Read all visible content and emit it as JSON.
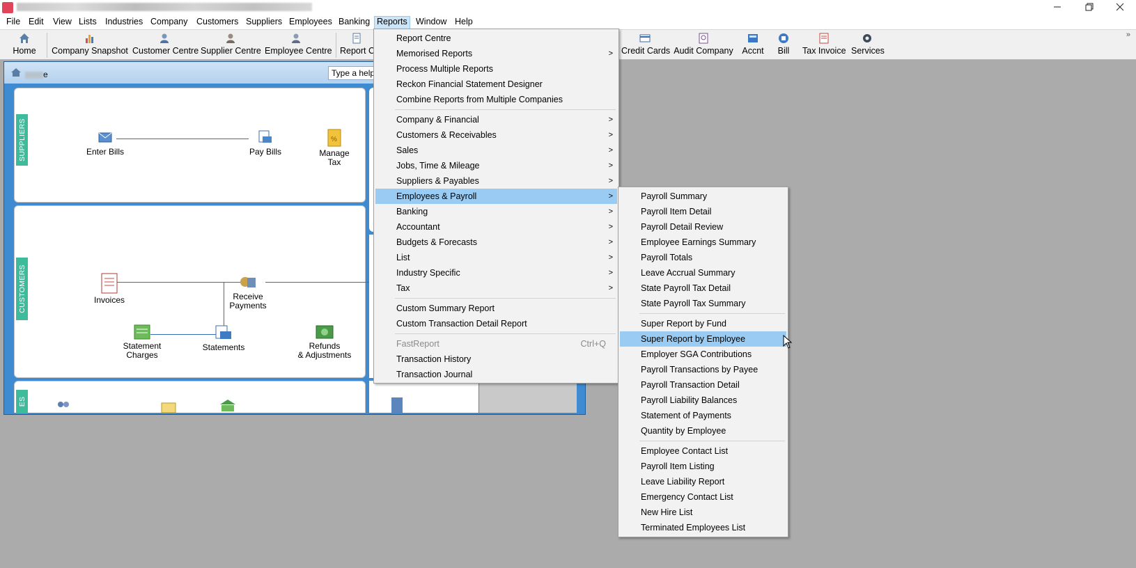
{
  "titlebar": {
    "minimize": "—",
    "restore": "❐",
    "close": "✕"
  },
  "menubar": [
    "File",
    "Edit",
    "View",
    "Lists",
    "Industries",
    "Company",
    "Customers",
    "Suppliers",
    "Employees",
    "Banking",
    "Reports",
    "Window",
    "Help"
  ],
  "toolbar": {
    "left": [
      {
        "label": "Home",
        "icon": "home-icon"
      },
      {
        "label": "Company Snapshot",
        "icon": "chart-icon"
      },
      {
        "label": "Customer Centre",
        "icon": "customer-icon"
      },
      {
        "label": "Supplier Centre",
        "icon": "supplier-icon"
      },
      {
        "label": "Employee Centre",
        "icon": "employee-icon"
      },
      {
        "label": "Report C",
        "icon": "report-icon"
      }
    ],
    "right": [
      {
        "label": "Credit Cards",
        "icon": "credit-card-icon"
      },
      {
        "label": "Audit Company",
        "icon": "audit-icon"
      },
      {
        "label": "Accnt",
        "icon": "account-icon"
      },
      {
        "label": "Bill",
        "icon": "bill-icon"
      },
      {
        "label": "Tax Invoice",
        "icon": "tax-invoice-icon"
      },
      {
        "label": "Services",
        "icon": "gear-icon"
      }
    ],
    "overflow": "»"
  },
  "home": {
    "title_suffix": "e",
    "help_text": "Type a help q",
    "sections": {
      "suppliers": "SUPPLIERS",
      "customers": "CUSTOMERS",
      "employees": "ES"
    },
    "nodes": {
      "enter_bills": "Enter Bills",
      "pay_bills": "Pay Bills",
      "manage_tax_1": "Manage",
      "manage_tax_2": "Tax",
      "invoices": "Invoices",
      "receive_payments_1": "Receive",
      "receive_payments_2": "Payments",
      "statement_charges_1": "Statement",
      "statement_charges_2": "Charges",
      "statements": "Statements",
      "refunds_1": "Refunds",
      "refunds_2": "& Adjustments"
    }
  },
  "reports_menu": {
    "group1": [
      "Report Centre",
      "Memorised Reports",
      "Process Multiple Reports",
      "Reckon Financial Statement Designer",
      "Combine Reports from Multiple Companies"
    ],
    "group2": [
      "Company & Financial",
      "Customers & Receivables",
      "Sales",
      "Jobs, Time & Mileage",
      "Suppliers & Payables",
      "Employees & Payroll",
      "Banking",
      "Accountant",
      "Budgets & Forecasts",
      "List",
      "Industry Specific",
      "Tax"
    ],
    "group3": [
      "Custom Summary Report",
      "Custom Transaction Detail Report"
    ],
    "group4": [
      "FastReport",
      "Transaction History",
      "Transaction Journal"
    ],
    "fastreport_shortcut": "Ctrl+Q",
    "highlighted": "Employees & Payroll"
  },
  "payroll_submenu": {
    "group1": [
      "Payroll Summary",
      "Payroll Item Detail",
      "Payroll Detail Review",
      "Employee Earnings Summary",
      "Payroll Totals",
      "Leave Accrual Summary",
      "State Payroll Tax Detail",
      "State Payroll Tax Summary"
    ],
    "group2": [
      "Super Report by Fund",
      "Super Report by Employee",
      "Employer SGA Contributions",
      "Payroll Transactions by Payee",
      "Payroll Transaction Detail",
      "Payroll Liability Balances",
      "Statement of Payments",
      "Quantity by Employee"
    ],
    "group3": [
      "Employee Contact List",
      "Payroll Item Listing",
      "Leave Liability Report",
      "Emergency Contact List",
      "New Hire List",
      "Terminated Employees List"
    ],
    "highlighted": "Super Report by Employee"
  }
}
